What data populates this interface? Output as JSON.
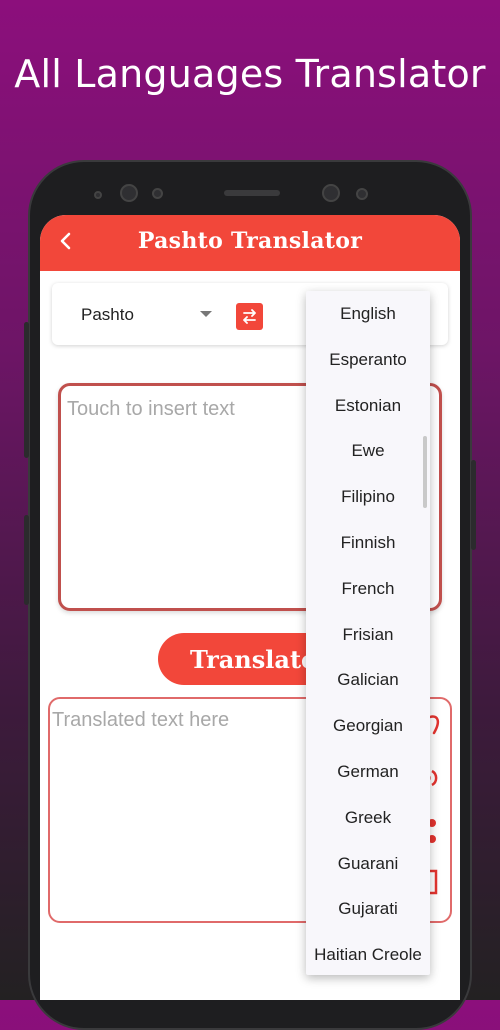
{
  "promo": {
    "title": "All Languages Translator"
  },
  "appbar": {
    "title": "Pashto Translator"
  },
  "language_bar": {
    "source_language": "Pashto"
  },
  "input": {
    "placeholder": "Touch to insert text"
  },
  "translate_button": {
    "label": "Translate"
  },
  "output": {
    "placeholder": "Translated text here"
  },
  "dropdown": {
    "items": [
      "English",
      "Esperanto",
      "Estonian",
      "Ewe",
      "Filipino",
      "Finnish",
      "French",
      "Frisian",
      "Galician",
      "Georgian",
      "German",
      "Greek",
      "Guarani",
      "Gujarati",
      "Haitian Creole"
    ]
  },
  "colors": {
    "accent": "#f2473a",
    "background_top": "#8c0f7c",
    "background_bottom": "#232122"
  }
}
